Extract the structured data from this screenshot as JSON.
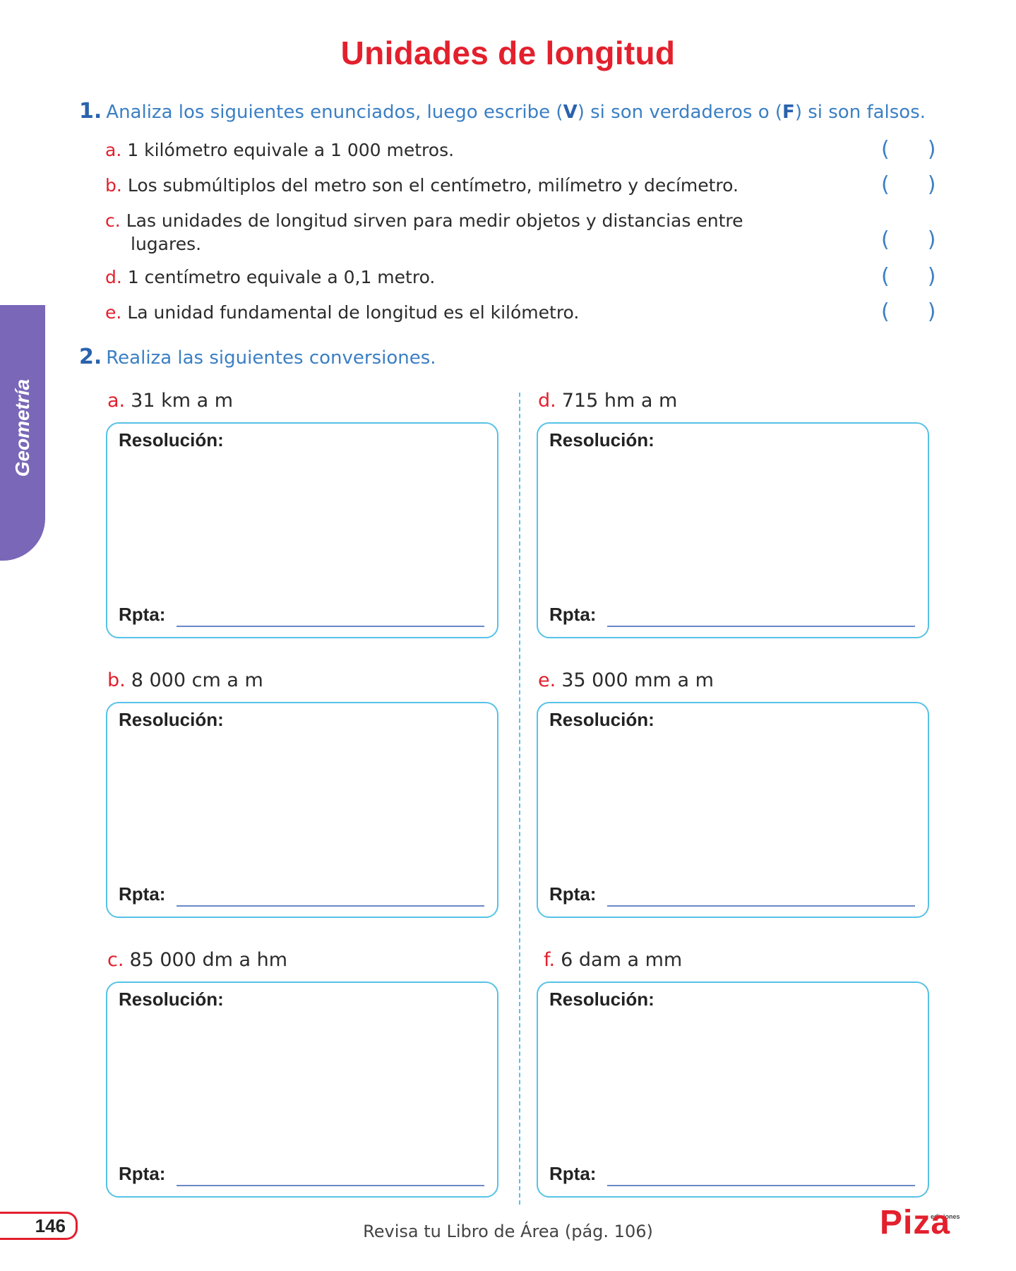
{
  "title": "Unidades de longitud",
  "side_tab": "Geometría",
  "q1": {
    "number": "1.",
    "text_before": "Analiza los siguientes enunciados, luego escribe (",
    "v": "V",
    "text_mid": ") si son verdaderos o (",
    "f": "F",
    "text_after": ") si son falsos.",
    "items": [
      {
        "letter": "a.",
        "line1": "1 kilómetro equivale a 1 000 metros.",
        "line2": ""
      },
      {
        "letter": "b.",
        "line1": "Los submúltiplos del metro son el centímetro, milímetro y decímetro.",
        "line2": ""
      },
      {
        "letter": "c.",
        "line1": "Las unidades de longitud sirven para medir objetos y distancias entre",
        "line2": "lugares."
      },
      {
        "letter": "d.",
        "line1": "1 centímetro equivale a 0,1 metro.",
        "line2": ""
      },
      {
        "letter": "e.",
        "line1": "La unidad fundamental de longitud es el kilómetro.",
        "line2": ""
      }
    ],
    "paren_open": "(",
    "paren_close": ")"
  },
  "q2": {
    "number": "2.",
    "text": "Realiza las siguientes conversiones.",
    "resolution_label": "Resolución:",
    "answer_label": "Rpta:",
    "items": [
      {
        "letter": "a.",
        "text": "31 km a m"
      },
      {
        "letter": "b.",
        "text": "8 000 cm a m"
      },
      {
        "letter": "c.",
        "text": "85 000 dm a hm"
      },
      {
        "letter": "d.",
        "text": "715 hm a m"
      },
      {
        "letter": "e.",
        "text": "35 000 mm a m"
      },
      {
        "letter": "f.",
        "text": "6 dam a mm"
      }
    ]
  },
  "footer": {
    "page_number": "146",
    "review_text": "Revisa tu Libro de Área (pág. 106)",
    "logo_small": "ediciones",
    "logo_word": "Piza"
  },
  "colors": {
    "title_red": "#e3202d",
    "instruction_blue": "#3b7fc4",
    "box_border_cyan": "#56c2e6",
    "side_tab_purple": "#7a67b8"
  }
}
